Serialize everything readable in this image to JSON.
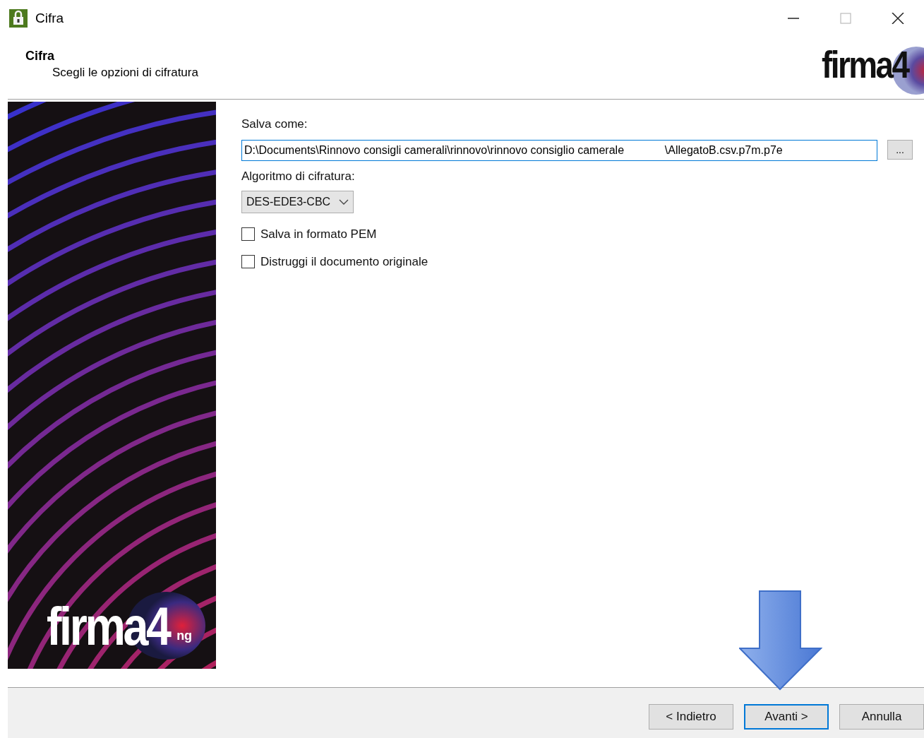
{
  "window": {
    "title": "Cifra",
    "controls": [
      {
        "kind": "minimize"
      },
      {
        "kind": "maximize"
      },
      {
        "kind": "close"
      }
    ]
  },
  "header": {
    "title": "Cifra",
    "subtitle": "Scegli le opzioni di cifratura",
    "logo": "firma4"
  },
  "banner": {
    "logo": "firma4",
    "logo_suffix": "ng"
  },
  "form": {
    "save_as_label": "Salva come:",
    "save_as_value": "D:\\Documents\\Rinnovo consigli camerali\\rinnovo\\rinnovo consiglio camerale             \\AllegatoB.csv.p7m.p7e",
    "browse_button": "...",
    "algorithm_label": "Algoritmo di cifratura:",
    "algorithm_value": "DES-EDE3-CBC",
    "options": [
      {
        "label": "Salva in formato PEM",
        "checked": false
      },
      {
        "label": "Distruggi il documento originale",
        "checked": false
      }
    ]
  },
  "buttons": [
    {
      "label": "< Indietro",
      "default": false
    },
    {
      "label": "Avanti >",
      "default": true
    },
    {
      "label": "Annulla",
      "default": false
    }
  ],
  "annotation": {
    "kind": "arrow-down"
  }
}
